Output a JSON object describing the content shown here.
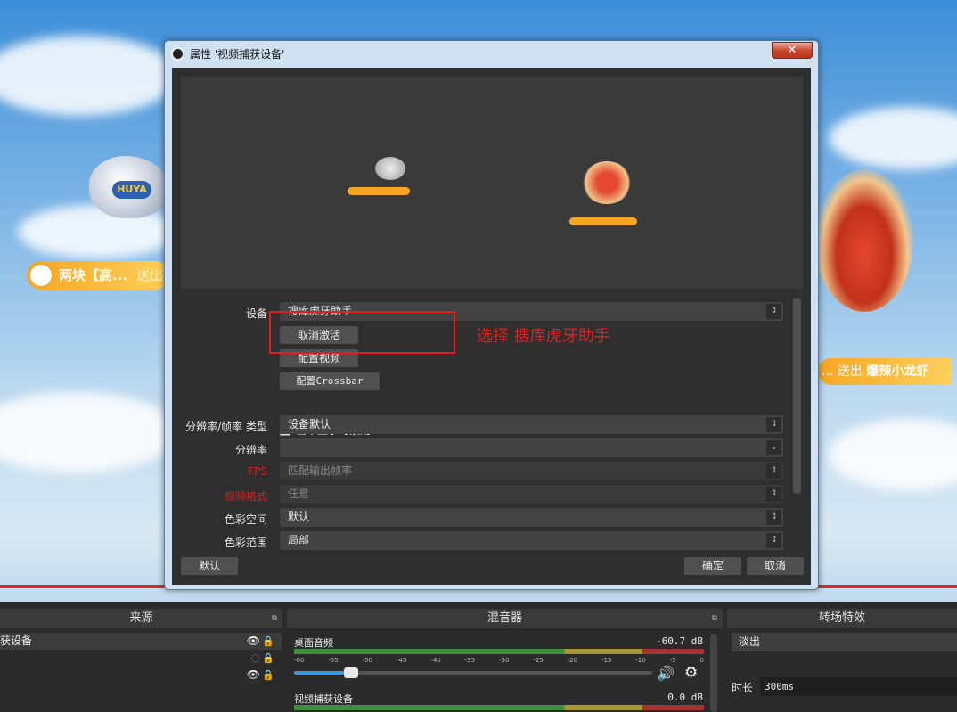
{
  "background": {
    "balloon_logo": "HUYA",
    "gift_left": {
      "text": "两块【高...",
      "action": "送出"
    },
    "gift_right": {
      "prefix": "...",
      "action": "送出",
      "item": "爆辣小龙虾"
    }
  },
  "dialog": {
    "title": "属性 '视频捕获设备'",
    "close_label": "✕",
    "annotation": "选择 搜库虎牙助手",
    "device": {
      "label": "设备",
      "value": "搜库虎牙助手"
    },
    "buttons": {
      "deactivate": "取消激活",
      "configure_video": "配置视频",
      "configure_crossbar": "配置Crossbar"
    },
    "checkbox": {
      "label": "当不显示时禁用",
      "checked": false
    },
    "fields": [
      {
        "label": "分辨率/帧率 类型",
        "value": "设备默认",
        "arrow": "⇕",
        "red": false,
        "disabled": false
      },
      {
        "label": "分辨率",
        "value": "",
        "arrow": "⌄",
        "red": false,
        "disabled": false
      },
      {
        "label": "FPS",
        "value": "匹配输出帧率",
        "arrow": "⇕",
        "red": true,
        "disabled": true
      },
      {
        "label": "视频格式",
        "value": "任意",
        "arrow": "⇕",
        "red": true,
        "disabled": true
      },
      {
        "label": "色彩空间",
        "value": "默认",
        "arrow": "⇕",
        "red": false,
        "disabled": false
      },
      {
        "label": "色彩范围",
        "value": "局部",
        "arrow": "⇕",
        "red": false,
        "disabled": false
      }
    ],
    "footer": {
      "defaults": "默认",
      "ok": "确定",
      "cancel": "取消"
    }
  },
  "sources_panel": {
    "title": "来源",
    "items": [
      {
        "name": "获设备",
        "eye": "👁",
        "lock": "🔒"
      },
      {
        "name": "",
        "eye": "◌",
        "lock": "🔒"
      },
      {
        "name": "",
        "eye": "👁",
        "lock": "🔒"
      }
    ]
  },
  "mixer_panel": {
    "title": "混音器",
    "channels": [
      {
        "name": "桌面音频",
        "db": "-60.7 dB",
        "volume_fraction": 0.16
      },
      {
        "name": "视频捕获设备",
        "db": "0.0 dB"
      }
    ],
    "scale": [
      "-60",
      "-55",
      "-50",
      "-45",
      "-40",
      "-35",
      "-30",
      "-25",
      "-20",
      "-15",
      "-10",
      "-5",
      "0"
    ]
  },
  "transition_panel": {
    "title": "转场特效",
    "selected": "淡出",
    "duration_label": "时长",
    "duration_value": "300ms"
  },
  "colors": {
    "accent_blue": "#3c9ae0",
    "annotation_red": "#e02020",
    "dialog_bg": "#2f2f2f"
  }
}
